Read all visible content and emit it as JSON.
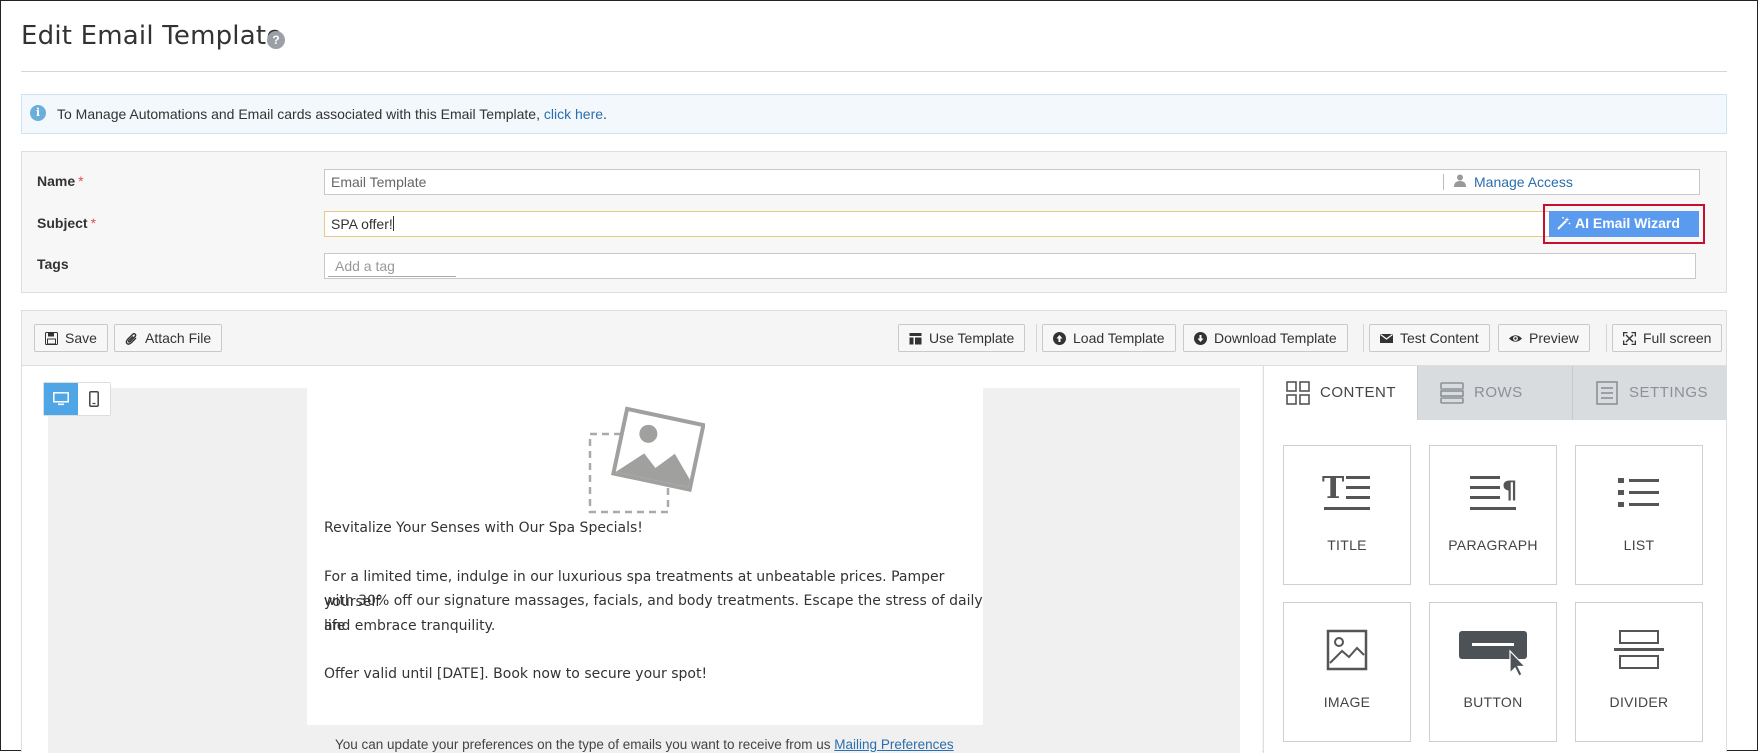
{
  "header": {
    "title": "Edit Email Template",
    "help_icon": "question-circle-icon",
    "help_glyph": "?"
  },
  "info_bar": {
    "icon": "info-icon",
    "icon_glyph": "i",
    "text": "To Manage Automations and Email cards associated with this Email Template, ",
    "link": "click here",
    "suffix": "."
  },
  "form": {
    "name_label": "Name",
    "subject_label": "Subject",
    "tags_label": "Tags",
    "required_mark": "*",
    "name_placeholder": "Email Template",
    "manage_access": "Manage Access",
    "subject_value": "SPA offer!",
    "ai_wizard": "AI Email Wizard",
    "tag_placeholder": "Add a tag"
  },
  "toolbar": {
    "save": "Save",
    "attach": "Attach File",
    "use_template": "Use Template",
    "load_template": "Load Template",
    "download_template": "Download Template",
    "test_content": "Test Content",
    "preview": "Preview",
    "full_screen": "Full screen"
  },
  "email": {
    "headline": "Revitalize Your Senses with Our Spa Specials!",
    "para1_line1": "For a limited time, indulge in our luxurious spa treatments at unbeatable prices. Pamper yourself",
    "para1_line2": "with 30% off our signature massages, facials, and body treatments. Escape the stress of daily life",
    "para1_line3": "and embrace tranquility.",
    "para2": "Offer valid until [DATE]. Book now to secure your spot!",
    "footer_text": "You can update your preferences on the type of emails you want to receive from us ",
    "footer_link": "Mailing Preferences"
  },
  "side_panel": {
    "tabs": [
      "CONTENT",
      "ROWS",
      "SETTINGS"
    ],
    "tiles": [
      "TITLE",
      "PARAGRAPH",
      "LIST",
      "IMAGE",
      "BUTTON",
      "DIVIDER"
    ]
  },
  "colors": {
    "accent_blue": "#4ea6e6",
    "ai_button": "#5b9bef",
    "highlight_red": "#c8102e",
    "link": "#2a6ead"
  }
}
